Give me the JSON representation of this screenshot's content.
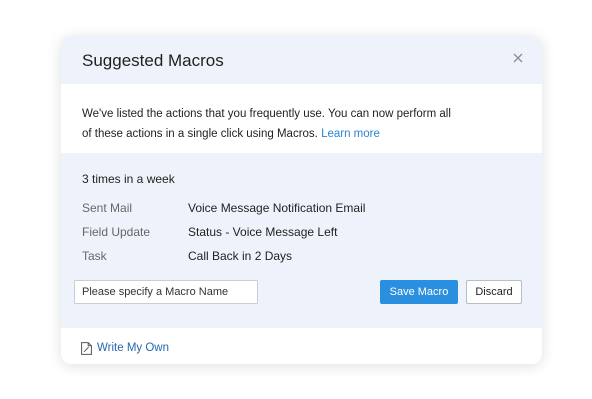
{
  "dialog": {
    "title": "Suggested Macros",
    "close_icon": "close-icon"
  },
  "intro": {
    "text": "We've listed the actions that you frequently use. You can now perform all of these actions in a single click using Macros.",
    "link_label": "Learn more"
  },
  "suggestion": {
    "frequency": "3 times in a week",
    "actions": [
      {
        "label": "Sent Mail",
        "value": "Voice Message Notification Email"
      },
      {
        "label": "Field Update",
        "value": "Status - Voice Message Left"
      },
      {
        "label": "Task",
        "value": "Call Back in 2 Days"
      }
    ],
    "name_placeholder": "Please specify a Macro Name",
    "save_label": "Save Macro",
    "discard_label": "Discard"
  },
  "footer": {
    "write_own_label": "Write My Own",
    "write_own_icon": "document-icon"
  },
  "colors": {
    "panel_bg": "#eef3fb",
    "accent": "#2a8fdf",
    "link": "#2a83d8"
  }
}
